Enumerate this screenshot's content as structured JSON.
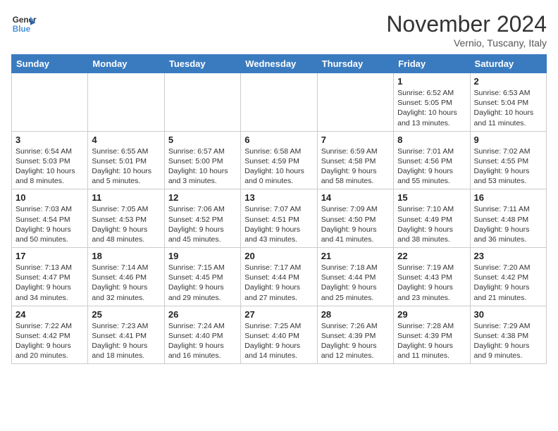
{
  "header": {
    "logo_line1": "General",
    "logo_line2": "Blue",
    "month": "November 2024",
    "location": "Vernio, Tuscany, Italy"
  },
  "weekdays": [
    "Sunday",
    "Monday",
    "Tuesday",
    "Wednesday",
    "Thursday",
    "Friday",
    "Saturday"
  ],
  "weeks": [
    [
      {
        "day": "",
        "info": ""
      },
      {
        "day": "",
        "info": ""
      },
      {
        "day": "",
        "info": ""
      },
      {
        "day": "",
        "info": ""
      },
      {
        "day": "",
        "info": ""
      },
      {
        "day": "1",
        "info": "Sunrise: 6:52 AM\nSunset: 5:05 PM\nDaylight: 10 hours\nand 13 minutes."
      },
      {
        "day": "2",
        "info": "Sunrise: 6:53 AM\nSunset: 5:04 PM\nDaylight: 10 hours\nand 11 minutes."
      }
    ],
    [
      {
        "day": "3",
        "info": "Sunrise: 6:54 AM\nSunset: 5:03 PM\nDaylight: 10 hours\nand 8 minutes."
      },
      {
        "day": "4",
        "info": "Sunrise: 6:55 AM\nSunset: 5:01 PM\nDaylight: 10 hours\nand 5 minutes."
      },
      {
        "day": "5",
        "info": "Sunrise: 6:57 AM\nSunset: 5:00 PM\nDaylight: 10 hours\nand 3 minutes."
      },
      {
        "day": "6",
        "info": "Sunrise: 6:58 AM\nSunset: 4:59 PM\nDaylight: 10 hours\nand 0 minutes."
      },
      {
        "day": "7",
        "info": "Sunrise: 6:59 AM\nSunset: 4:58 PM\nDaylight: 9 hours\nand 58 minutes."
      },
      {
        "day": "8",
        "info": "Sunrise: 7:01 AM\nSunset: 4:56 PM\nDaylight: 9 hours\nand 55 minutes."
      },
      {
        "day": "9",
        "info": "Sunrise: 7:02 AM\nSunset: 4:55 PM\nDaylight: 9 hours\nand 53 minutes."
      }
    ],
    [
      {
        "day": "10",
        "info": "Sunrise: 7:03 AM\nSunset: 4:54 PM\nDaylight: 9 hours\nand 50 minutes."
      },
      {
        "day": "11",
        "info": "Sunrise: 7:05 AM\nSunset: 4:53 PM\nDaylight: 9 hours\nand 48 minutes."
      },
      {
        "day": "12",
        "info": "Sunrise: 7:06 AM\nSunset: 4:52 PM\nDaylight: 9 hours\nand 45 minutes."
      },
      {
        "day": "13",
        "info": "Sunrise: 7:07 AM\nSunset: 4:51 PM\nDaylight: 9 hours\nand 43 minutes."
      },
      {
        "day": "14",
        "info": "Sunrise: 7:09 AM\nSunset: 4:50 PM\nDaylight: 9 hours\nand 41 minutes."
      },
      {
        "day": "15",
        "info": "Sunrise: 7:10 AM\nSunset: 4:49 PM\nDaylight: 9 hours\nand 38 minutes."
      },
      {
        "day": "16",
        "info": "Sunrise: 7:11 AM\nSunset: 4:48 PM\nDaylight: 9 hours\nand 36 minutes."
      }
    ],
    [
      {
        "day": "17",
        "info": "Sunrise: 7:13 AM\nSunset: 4:47 PM\nDaylight: 9 hours\nand 34 minutes."
      },
      {
        "day": "18",
        "info": "Sunrise: 7:14 AM\nSunset: 4:46 PM\nDaylight: 9 hours\nand 32 minutes."
      },
      {
        "day": "19",
        "info": "Sunrise: 7:15 AM\nSunset: 4:45 PM\nDaylight: 9 hours\nand 29 minutes."
      },
      {
        "day": "20",
        "info": "Sunrise: 7:17 AM\nSunset: 4:44 PM\nDaylight: 9 hours\nand 27 minutes."
      },
      {
        "day": "21",
        "info": "Sunrise: 7:18 AM\nSunset: 4:44 PM\nDaylight: 9 hours\nand 25 minutes."
      },
      {
        "day": "22",
        "info": "Sunrise: 7:19 AM\nSunset: 4:43 PM\nDaylight: 9 hours\nand 23 minutes."
      },
      {
        "day": "23",
        "info": "Sunrise: 7:20 AM\nSunset: 4:42 PM\nDaylight: 9 hours\nand 21 minutes."
      }
    ],
    [
      {
        "day": "24",
        "info": "Sunrise: 7:22 AM\nSunset: 4:42 PM\nDaylight: 9 hours\nand 20 minutes."
      },
      {
        "day": "25",
        "info": "Sunrise: 7:23 AM\nSunset: 4:41 PM\nDaylight: 9 hours\nand 18 minutes."
      },
      {
        "day": "26",
        "info": "Sunrise: 7:24 AM\nSunset: 4:40 PM\nDaylight: 9 hours\nand 16 minutes."
      },
      {
        "day": "27",
        "info": "Sunrise: 7:25 AM\nSunset: 4:40 PM\nDaylight: 9 hours\nand 14 minutes."
      },
      {
        "day": "28",
        "info": "Sunrise: 7:26 AM\nSunset: 4:39 PM\nDaylight: 9 hours\nand 12 minutes."
      },
      {
        "day": "29",
        "info": "Sunrise: 7:28 AM\nSunset: 4:39 PM\nDaylight: 9 hours\nand 11 minutes."
      },
      {
        "day": "30",
        "info": "Sunrise: 7:29 AM\nSunset: 4:38 PM\nDaylight: 9 hours\nand 9 minutes."
      }
    ]
  ]
}
